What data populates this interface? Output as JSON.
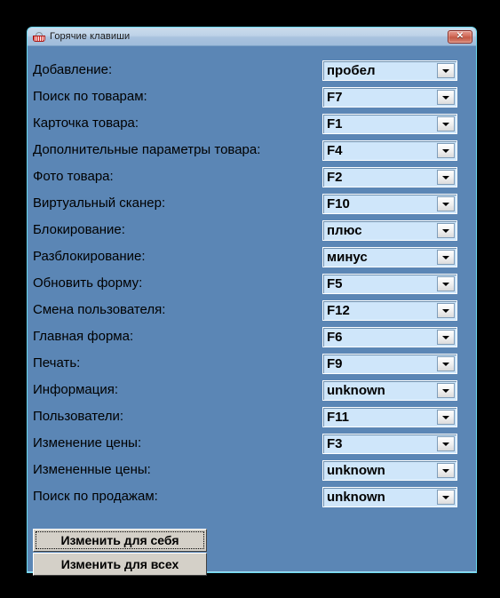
{
  "window": {
    "title": "Горячие клавиши",
    "icon": "basket-icon",
    "close_label": "✕",
    "colors": {
      "page_background": "#000000",
      "window_background": "#5b86b5",
      "window_border": "#6ad8f0",
      "titlebar_gradient_top": "#ccdcec",
      "titlebar_gradient_bottom": "#9fbcdb",
      "combo_background": "#cfe6fa",
      "button_face": "#d4d0c8",
      "close_button": "#c45946",
      "text": "#000000"
    }
  },
  "rows": [
    {
      "label": "Добавление:",
      "value": "пробел"
    },
    {
      "label": "Поиск по товарам:",
      "value": "F7"
    },
    {
      "label": "Карточка товара:",
      "value": "F1"
    },
    {
      "label": "Дополнительные параметры товара:",
      "value": "F4"
    },
    {
      "label": "Фото товара:",
      "value": "F2"
    },
    {
      "label": "Виртуальный сканер:",
      "value": "F10"
    },
    {
      "label": "Блокирование:",
      "value": "плюс"
    },
    {
      "label": "Разблокирование:",
      "value": "минус"
    },
    {
      "label": "Обновить форму:",
      "value": "F5"
    },
    {
      "label": "Смена пользователя:",
      "value": "F12"
    },
    {
      "label": "Главная форма:",
      "value": "F6"
    },
    {
      "label": "Печать:",
      "value": "F9"
    },
    {
      "label": "Информация:",
      "value": "unknown"
    },
    {
      "label": "Пользователи:",
      "value": "F11"
    },
    {
      "label": "Изменение цены:",
      "value": "F3"
    },
    {
      "label": "Измененные цены:",
      "value": "unknown"
    },
    {
      "label": "Поиск по продажам:",
      "value": "unknown"
    }
  ],
  "buttons": [
    {
      "label": "Изменить для себя",
      "focused": true
    },
    {
      "label": "Изменить для всех",
      "focused": false
    }
  ]
}
